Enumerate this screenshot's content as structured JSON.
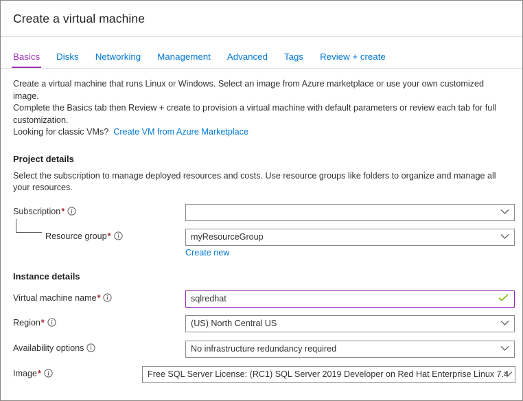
{
  "header": {
    "title": "Create a virtual machine"
  },
  "tabs": [
    {
      "label": "Basics",
      "selected": true
    },
    {
      "label": "Disks",
      "selected": false
    },
    {
      "label": "Networking",
      "selected": false
    },
    {
      "label": "Management",
      "selected": false
    },
    {
      "label": "Advanced",
      "selected": false
    },
    {
      "label": "Tags",
      "selected": false
    },
    {
      "label": "Review + create",
      "selected": false
    }
  ],
  "intro": {
    "line1": "Create a virtual machine that runs Linux or Windows. Select an image from Azure marketplace or use your own customized image.",
    "line2": "Complete the Basics tab then Review + create to provision a virtual machine with default parameters or review each tab for full customization.",
    "line3_prefix": "Looking for classic VMs?",
    "line3_link": "Create VM from Azure Marketplace"
  },
  "project_details": {
    "title": "Project details",
    "description": "Select the subscription to manage deployed resources and costs. Use resource groups like folders to organize and manage all your resources.",
    "subscription": {
      "label": "Subscription",
      "required": "*",
      "value": "",
      "icon": "info-icon"
    },
    "resource_group": {
      "label": "Resource group",
      "required": "*",
      "value": "myResourceGroup",
      "create_new_link": "Create new",
      "icon": "info-icon"
    }
  },
  "instance_details": {
    "title": "Instance details",
    "vm_name": {
      "label": "Virtual machine name",
      "required": "*",
      "value": "sqlredhat",
      "valid": true,
      "icon": "info-icon"
    },
    "region": {
      "label": "Region",
      "required": "*",
      "value": "(US) North Central US",
      "icon": "info-icon"
    },
    "availability_options": {
      "label": "Availability options",
      "required": "",
      "value": "No infrastructure redundancy required",
      "icon": "info-icon"
    },
    "image": {
      "label": "Image",
      "required": "*",
      "value": "Free SQL Server License: (RC1) SQL Server 2019 Developer on Red Hat Enterprise Linux 7.4",
      "icon": "info-icon"
    }
  },
  "colors": {
    "accent_blue": "#0078d4",
    "selected_tab_purple": "#9b30b8",
    "required_red": "#a4262c",
    "valid_green": "#7fba00",
    "focus_border": "#9326b3"
  }
}
